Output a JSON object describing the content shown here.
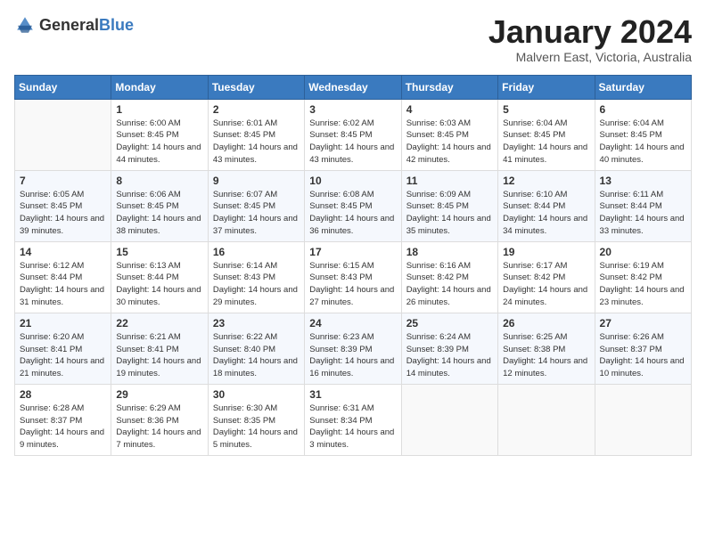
{
  "logo": {
    "text_general": "General",
    "text_blue": "Blue"
  },
  "header": {
    "month_title": "January 2024",
    "location": "Malvern East, Victoria, Australia"
  },
  "days_of_week": [
    "Sunday",
    "Monday",
    "Tuesday",
    "Wednesday",
    "Thursday",
    "Friday",
    "Saturday"
  ],
  "weeks": [
    [
      {
        "day": "",
        "sunrise": "",
        "sunset": "",
        "daylight": ""
      },
      {
        "day": "1",
        "sunrise": "Sunrise: 6:00 AM",
        "sunset": "Sunset: 8:45 PM",
        "daylight": "Daylight: 14 hours and 44 minutes."
      },
      {
        "day": "2",
        "sunrise": "Sunrise: 6:01 AM",
        "sunset": "Sunset: 8:45 PM",
        "daylight": "Daylight: 14 hours and 43 minutes."
      },
      {
        "day": "3",
        "sunrise": "Sunrise: 6:02 AM",
        "sunset": "Sunset: 8:45 PM",
        "daylight": "Daylight: 14 hours and 43 minutes."
      },
      {
        "day": "4",
        "sunrise": "Sunrise: 6:03 AM",
        "sunset": "Sunset: 8:45 PM",
        "daylight": "Daylight: 14 hours and 42 minutes."
      },
      {
        "day": "5",
        "sunrise": "Sunrise: 6:04 AM",
        "sunset": "Sunset: 8:45 PM",
        "daylight": "Daylight: 14 hours and 41 minutes."
      },
      {
        "day": "6",
        "sunrise": "Sunrise: 6:04 AM",
        "sunset": "Sunset: 8:45 PM",
        "daylight": "Daylight: 14 hours and 40 minutes."
      }
    ],
    [
      {
        "day": "7",
        "sunrise": "Sunrise: 6:05 AM",
        "sunset": "Sunset: 8:45 PM",
        "daylight": "Daylight: 14 hours and 39 minutes."
      },
      {
        "day": "8",
        "sunrise": "Sunrise: 6:06 AM",
        "sunset": "Sunset: 8:45 PM",
        "daylight": "Daylight: 14 hours and 38 minutes."
      },
      {
        "day": "9",
        "sunrise": "Sunrise: 6:07 AM",
        "sunset": "Sunset: 8:45 PM",
        "daylight": "Daylight: 14 hours and 37 minutes."
      },
      {
        "day": "10",
        "sunrise": "Sunrise: 6:08 AM",
        "sunset": "Sunset: 8:45 PM",
        "daylight": "Daylight: 14 hours and 36 minutes."
      },
      {
        "day": "11",
        "sunrise": "Sunrise: 6:09 AM",
        "sunset": "Sunset: 8:45 PM",
        "daylight": "Daylight: 14 hours and 35 minutes."
      },
      {
        "day": "12",
        "sunrise": "Sunrise: 6:10 AM",
        "sunset": "Sunset: 8:44 PM",
        "daylight": "Daylight: 14 hours and 34 minutes."
      },
      {
        "day": "13",
        "sunrise": "Sunrise: 6:11 AM",
        "sunset": "Sunset: 8:44 PM",
        "daylight": "Daylight: 14 hours and 33 minutes."
      }
    ],
    [
      {
        "day": "14",
        "sunrise": "Sunrise: 6:12 AM",
        "sunset": "Sunset: 8:44 PM",
        "daylight": "Daylight: 14 hours and 31 minutes."
      },
      {
        "day": "15",
        "sunrise": "Sunrise: 6:13 AM",
        "sunset": "Sunset: 8:44 PM",
        "daylight": "Daylight: 14 hours and 30 minutes."
      },
      {
        "day": "16",
        "sunrise": "Sunrise: 6:14 AM",
        "sunset": "Sunset: 8:43 PM",
        "daylight": "Daylight: 14 hours and 29 minutes."
      },
      {
        "day": "17",
        "sunrise": "Sunrise: 6:15 AM",
        "sunset": "Sunset: 8:43 PM",
        "daylight": "Daylight: 14 hours and 27 minutes."
      },
      {
        "day": "18",
        "sunrise": "Sunrise: 6:16 AM",
        "sunset": "Sunset: 8:42 PM",
        "daylight": "Daylight: 14 hours and 26 minutes."
      },
      {
        "day": "19",
        "sunrise": "Sunrise: 6:17 AM",
        "sunset": "Sunset: 8:42 PM",
        "daylight": "Daylight: 14 hours and 24 minutes."
      },
      {
        "day": "20",
        "sunrise": "Sunrise: 6:19 AM",
        "sunset": "Sunset: 8:42 PM",
        "daylight": "Daylight: 14 hours and 23 minutes."
      }
    ],
    [
      {
        "day": "21",
        "sunrise": "Sunrise: 6:20 AM",
        "sunset": "Sunset: 8:41 PM",
        "daylight": "Daylight: 14 hours and 21 minutes."
      },
      {
        "day": "22",
        "sunrise": "Sunrise: 6:21 AM",
        "sunset": "Sunset: 8:41 PM",
        "daylight": "Daylight: 14 hours and 19 minutes."
      },
      {
        "day": "23",
        "sunrise": "Sunrise: 6:22 AM",
        "sunset": "Sunset: 8:40 PM",
        "daylight": "Daylight: 14 hours and 18 minutes."
      },
      {
        "day": "24",
        "sunrise": "Sunrise: 6:23 AM",
        "sunset": "Sunset: 8:39 PM",
        "daylight": "Daylight: 14 hours and 16 minutes."
      },
      {
        "day": "25",
        "sunrise": "Sunrise: 6:24 AM",
        "sunset": "Sunset: 8:39 PM",
        "daylight": "Daylight: 14 hours and 14 minutes."
      },
      {
        "day": "26",
        "sunrise": "Sunrise: 6:25 AM",
        "sunset": "Sunset: 8:38 PM",
        "daylight": "Daylight: 14 hours and 12 minutes."
      },
      {
        "day": "27",
        "sunrise": "Sunrise: 6:26 AM",
        "sunset": "Sunset: 8:37 PM",
        "daylight": "Daylight: 14 hours and 10 minutes."
      }
    ],
    [
      {
        "day": "28",
        "sunrise": "Sunrise: 6:28 AM",
        "sunset": "Sunset: 8:37 PM",
        "daylight": "Daylight: 14 hours and 9 minutes."
      },
      {
        "day": "29",
        "sunrise": "Sunrise: 6:29 AM",
        "sunset": "Sunset: 8:36 PM",
        "daylight": "Daylight: 14 hours and 7 minutes."
      },
      {
        "day": "30",
        "sunrise": "Sunrise: 6:30 AM",
        "sunset": "Sunset: 8:35 PM",
        "daylight": "Daylight: 14 hours and 5 minutes."
      },
      {
        "day": "31",
        "sunrise": "Sunrise: 6:31 AM",
        "sunset": "Sunset: 8:34 PM",
        "daylight": "Daylight: 14 hours and 3 minutes."
      },
      {
        "day": "",
        "sunrise": "",
        "sunset": "",
        "daylight": ""
      },
      {
        "day": "",
        "sunrise": "",
        "sunset": "",
        "daylight": ""
      },
      {
        "day": "",
        "sunrise": "",
        "sunset": "",
        "daylight": ""
      }
    ]
  ]
}
